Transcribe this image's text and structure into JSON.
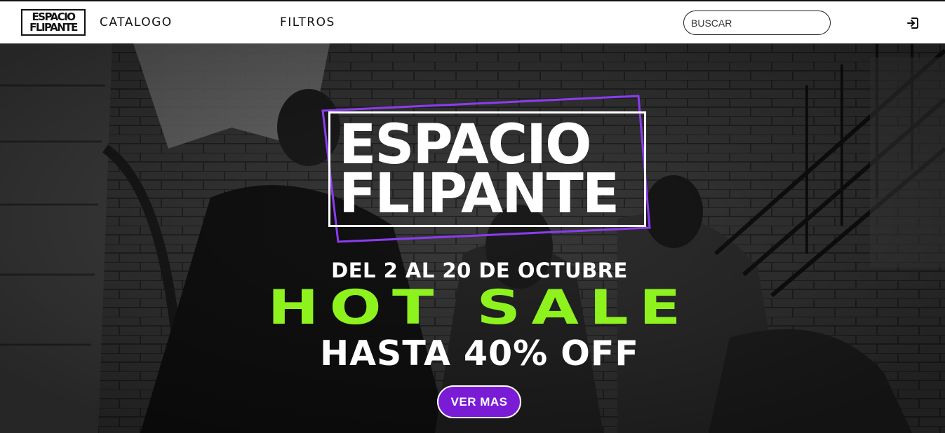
{
  "header": {
    "logo_line1": "ESPACIO",
    "logo_line2": "FLIPANTE",
    "nav": [
      {
        "label": "CATALOGO"
      },
      {
        "label": "FILTROS"
      }
    ],
    "search": {
      "placeholder": "BUSCAR",
      "value": ""
    },
    "login_icon": "login-icon"
  },
  "hero": {
    "brand_line1": "ESPACIO",
    "brand_line2": "FLIPANTE",
    "dates": "DEL 2 AL 20 DE OCTUBRE",
    "headline": "HOT SALE",
    "discount": "HASTA 40% OFF",
    "cta_label": "VER MAS",
    "colors": {
      "accent_green": "#8ef21e",
      "accent_purple": "#7a1bd6",
      "frame_purple": "#8b3cf0"
    }
  }
}
